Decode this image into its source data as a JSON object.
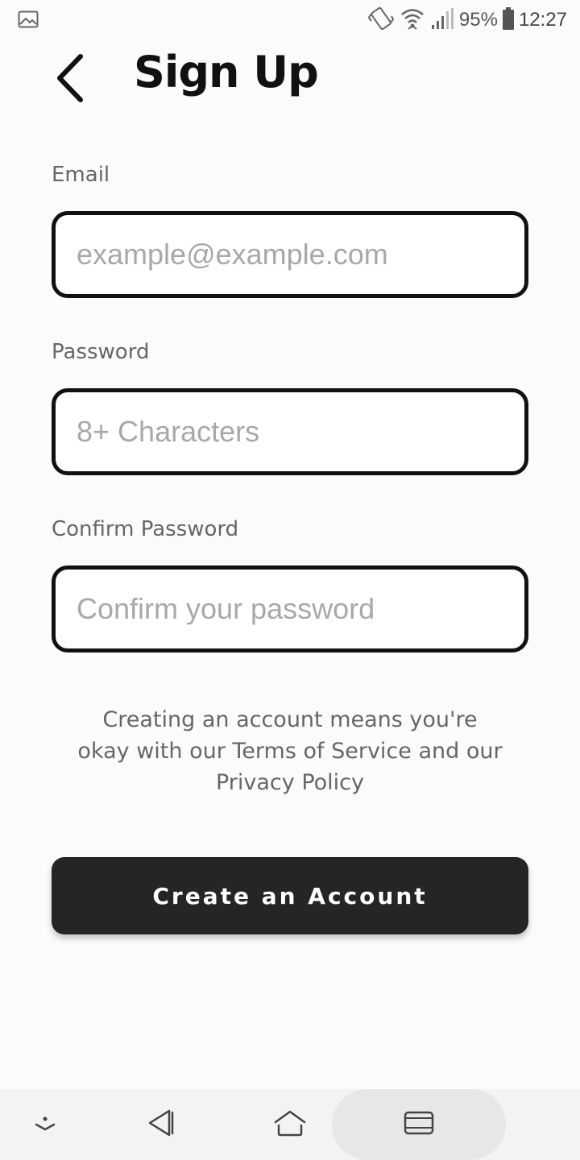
{
  "status_bar": {
    "left_icon": "image-icon",
    "icons": [
      "vibrate-icon",
      "wifi-icon",
      "signal-icon",
      "battery-icon"
    ],
    "battery_percent": "95%",
    "time": "12:27"
  },
  "header": {
    "back_icon": "chevron-left-icon",
    "title": "Sign Up"
  },
  "form": {
    "email": {
      "label": "Email",
      "value": "",
      "placeholder": "example@example.com"
    },
    "password": {
      "label": "Password",
      "value": "",
      "placeholder": "8+ Characters"
    },
    "confirm_password": {
      "label": "Confirm Password",
      "value": "",
      "placeholder": "Confirm your password"
    }
  },
  "terms": {
    "line1": "Creating an account means you're",
    "line2": "okay with our Terms of Service and our",
    "line3": "Privacy Policy"
  },
  "create_button": {
    "label": "Create an Account"
  },
  "colors": {
    "background": "#fbfbfb",
    "button": "#252525",
    "field_border": "#111111",
    "label": "#666666",
    "placeholder": "#a8a8a8"
  },
  "nav_bar": {
    "icons": [
      "keyboard-hide-icon",
      "nav-back-icon",
      "nav-home-icon",
      "nav-recents-icon"
    ]
  }
}
